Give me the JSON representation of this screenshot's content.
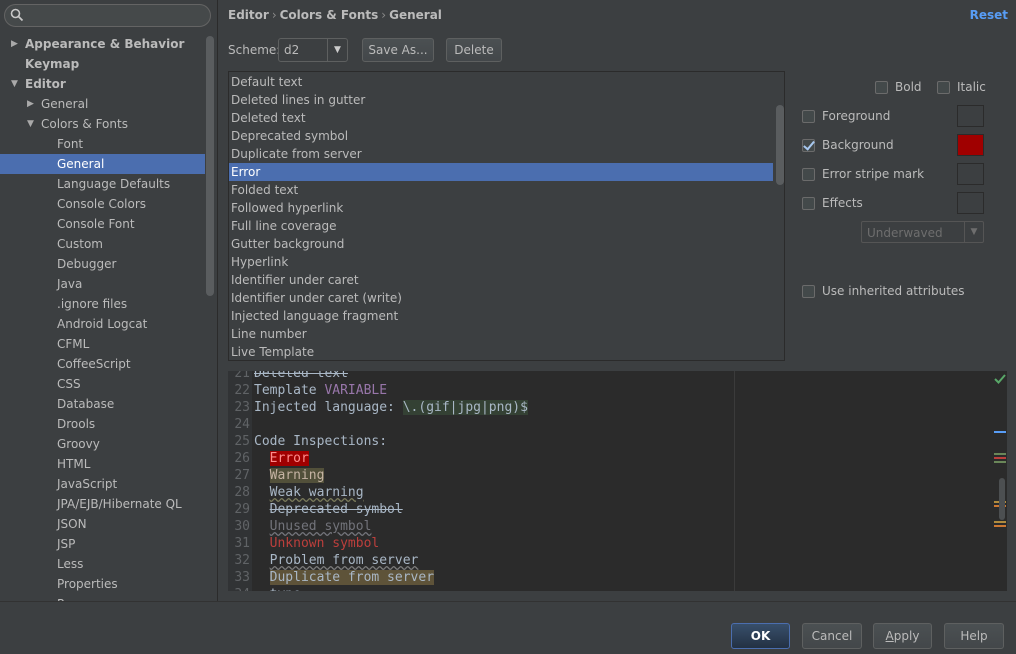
{
  "search": {
    "placeholder": ""
  },
  "breadcrumb": {
    "items": [
      "Editor",
      "Colors & Fonts",
      "General"
    ],
    "separator": "›"
  },
  "reset_label": "Reset",
  "scheme": {
    "label": "Scheme:",
    "value": "d2",
    "save_as_label": "Save As...",
    "delete_label": "Delete"
  },
  "tree": [
    {
      "label": "Appearance & Behavior",
      "level": 0,
      "expanded": false,
      "bold": true
    },
    {
      "label": "Keymap",
      "level": 0,
      "bold": true
    },
    {
      "label": "Editor",
      "level": 0,
      "expanded": true,
      "bold": true
    },
    {
      "label": "General",
      "level": 1,
      "expanded": false
    },
    {
      "label": "Colors & Fonts",
      "level": 1,
      "expanded": true
    },
    {
      "label": "Font",
      "level": 2
    },
    {
      "label": "General",
      "level": 2,
      "selected": true
    },
    {
      "label": "Language Defaults",
      "level": 2
    },
    {
      "label": "Console Colors",
      "level": 2
    },
    {
      "label": "Console Font",
      "level": 2
    },
    {
      "label": "Custom",
      "level": 2
    },
    {
      "label": "Debugger",
      "level": 2
    },
    {
      "label": "Java",
      "level": 2
    },
    {
      "label": ".ignore files",
      "level": 2
    },
    {
      "label": "Android Logcat",
      "level": 2
    },
    {
      "label": "CFML",
      "level": 2
    },
    {
      "label": "CoffeeScript",
      "level": 2
    },
    {
      "label": "CSS",
      "level": 2
    },
    {
      "label": "Database",
      "level": 2
    },
    {
      "label": "Drools",
      "level": 2
    },
    {
      "label": "Groovy",
      "level": 2
    },
    {
      "label": "HTML",
      "level": 2
    },
    {
      "label": "JavaScript",
      "level": 2
    },
    {
      "label": "JPA/EJB/Hibernate QL",
      "level": 2
    },
    {
      "label": "JSON",
      "level": 2
    },
    {
      "label": "JSP",
      "level": 2
    },
    {
      "label": "Less",
      "level": 2
    },
    {
      "label": "Properties",
      "level": 2
    },
    {
      "label": "Py…",
      "level": 2
    }
  ],
  "attributes": [
    "Default text",
    "Deleted lines in gutter",
    "Deleted text",
    "Deprecated symbol",
    "Duplicate from server",
    "Error",
    "Folded text",
    "Followed hyperlink",
    "Full line coverage",
    "Gutter background",
    "Hyperlink",
    "Identifier under caret",
    "Identifier under caret (write)",
    "Injected language fragment",
    "Line number",
    "Live Template"
  ],
  "selected_attribute_index": 5,
  "options": {
    "bold_label": "Bold",
    "bold_checked": false,
    "italic_label": "Italic",
    "italic_checked": false,
    "foreground_label": "Foreground",
    "foreground_checked": false,
    "background_label": "Background",
    "background_checked": true,
    "background_color": "#a00000",
    "error_stripe_label": "Error stripe mark",
    "error_stripe_checked": false,
    "effects_label": "Effects",
    "effects_checked": false,
    "effects_type": "Underwaved",
    "inherited_label": "Use inherited attributes",
    "inherited_checked": false
  },
  "preview": {
    "lines": [
      {
        "n": "21",
        "parts": [
          {
            "t": "Deleted text",
            "c": "dep"
          }
        ]
      },
      {
        "n": "22",
        "parts": [
          {
            "t": "Template "
          },
          {
            "t": "VARIABLE",
            "c": "var"
          }
        ]
      },
      {
        "n": "23",
        "parts": [
          {
            "t": "Injected language: "
          },
          {
            "t": "\\.(gif|jpg|png)$",
            "c": "re"
          }
        ]
      },
      {
        "n": "24",
        "parts": []
      },
      {
        "n": "25",
        "parts": [
          {
            "t": "Code Inspections:"
          }
        ]
      },
      {
        "n": "26",
        "parts": [
          {
            "t": "  "
          },
          {
            "t": "Error",
            "c": "errtok"
          }
        ]
      },
      {
        "n": "27",
        "parts": [
          {
            "t": "  "
          },
          {
            "t": "Warning",
            "c": "warntok"
          }
        ]
      },
      {
        "n": "28",
        "parts": [
          {
            "t": "  "
          },
          {
            "t": "Weak warning",
            "c": "weak"
          }
        ]
      },
      {
        "n": "29",
        "parts": [
          {
            "t": "  "
          },
          {
            "t": "Deprecated symbol",
            "c": "dep"
          }
        ]
      },
      {
        "n": "30",
        "parts": [
          {
            "t": "  "
          },
          {
            "t": "Unused symbol",
            "c": "unused"
          }
        ]
      },
      {
        "n": "31",
        "parts": [
          {
            "t": "  "
          },
          {
            "t": "Unknown symbol",
            "c": "unknown"
          }
        ]
      },
      {
        "n": "32",
        "parts": [
          {
            "t": "  "
          },
          {
            "t": "Problem from server",
            "c": "problem"
          }
        ]
      },
      {
        "n": "33",
        "parts": [
          {
            "t": "  "
          },
          {
            "t": "Duplicate from server",
            "c": "dup"
          }
        ]
      },
      {
        "n": "34",
        "parts": [
          {
            "t": "  type"
          }
        ]
      }
    ],
    "stripe_marks": [
      "#589df6",
      "#6a8759",
      "#bc3f3c",
      "#6a8759",
      "#b08b3e",
      "#cc7832",
      "#b08b3e",
      "#cc7832"
    ]
  },
  "footer": {
    "ok_label": "OK",
    "cancel_label": "Cancel",
    "apply_label": "Apply",
    "help_label": "Help"
  },
  "colors": {
    "selection": "#4b6eaf",
    "panel": "#3c3f41",
    "editor_bg": "#2b2b2b",
    "link": "#589df6"
  }
}
